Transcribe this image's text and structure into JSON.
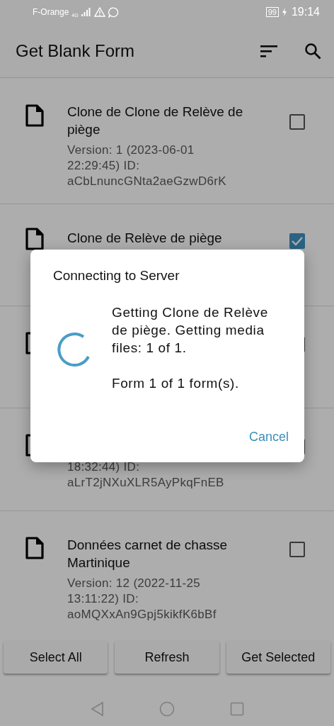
{
  "status_bar": {
    "carrier": "F-Orange",
    "network": "4G",
    "battery": "99",
    "time": "19:14"
  },
  "app_bar": {
    "title": "Get Blank Form"
  },
  "rows": [
    {
      "title": "Clone de Clone de Relève de piège",
      "subtitle": "Version: 1 (2023-06-01\n22:29:45) ID:\naCbLnuncGNta2aeGzwD6rK",
      "checked": false
    },
    {
      "title": "Clone de Relève de piège",
      "checked": true
    },
    {
      "checked": false
    },
    {
      "subtitle": "18:32:44) ID:\naLrT2jNXuXLR5AyPkqFnEB",
      "checked": false
    },
    {
      "title": "Données carnet de chasse Martinique",
      "subtitle": "Version: 12 (2022-11-25\n13:11:22) ID:\naoMQXxAn9Gpj5kikfK6bBf",
      "checked": false
    }
  ],
  "buttons": [
    {
      "label": "Select All"
    },
    {
      "label": "Refresh"
    },
    {
      "label": "Get Selected"
    }
  ],
  "dialog": {
    "title": "Connecting to Server",
    "message": "Getting Clone de Relève\nde piège. Getting media\nfiles: 1 of 1.\n\nForm 1 of 1 form(s).",
    "action": "Cancel"
  }
}
